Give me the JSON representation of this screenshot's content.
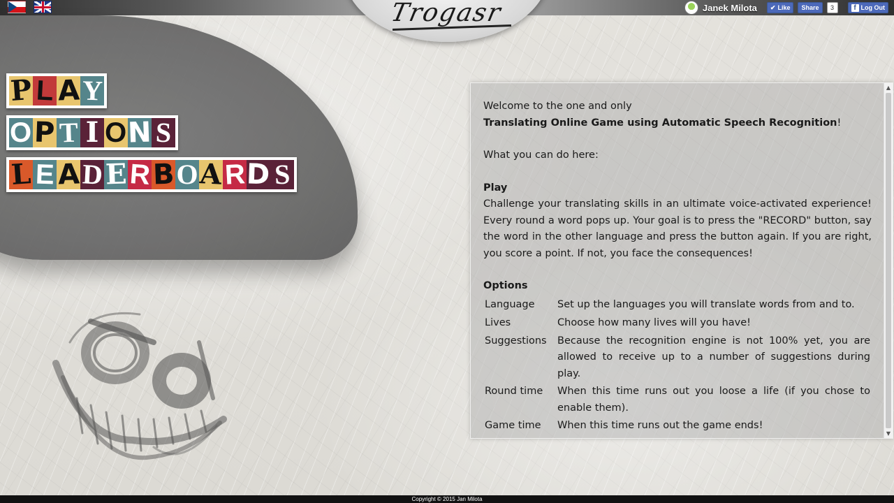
{
  "header": {
    "flags": [
      {
        "icon": "czech-flag-icon"
      },
      {
        "icon": "uk-flag-icon"
      }
    ],
    "user": {
      "name": "Janek Milota"
    },
    "facebook": {
      "like_label": "Like",
      "share_label": "Share",
      "share_count": "3",
      "logout_label": "Log Out"
    }
  },
  "logo": {
    "text": "Trogasr"
  },
  "menu": {
    "play": {
      "letters": [
        "P",
        "L",
        "A",
        "Y"
      ]
    },
    "options": {
      "letters": [
        "O",
        "P",
        "T",
        "I",
        "O",
        "N",
        "S"
      ]
    },
    "leaderboards": {
      "letters": [
        "L",
        "E",
        "A",
        "D",
        "E",
        "R",
        "B",
        "O",
        "A",
        "R",
        "D",
        "S"
      ]
    }
  },
  "colors": {
    "tile_yellow": "#e8c56e",
    "tile_red": "#c23a3a",
    "tile_teal": "#55858b",
    "tile_plum": "#5a2238",
    "tile_crimson": "#c52a45",
    "tile_orange": "#d9592a"
  },
  "info": {
    "intro_line1": "Welcome to the one and only",
    "intro_line2": "Translating Online Game using Automatic Speech Recognition",
    "intro_line2_suffix": "!",
    "what_you_can_do": "What you can do here:",
    "play_heading": "Play",
    "play_text": "Challenge your translating skills in an ultimate voice-activated experience! Every round a word pops up. Your goal is to press the \"RECORD\" button, say the word in the other language and press the button again. If you are right, you score a point. If not, you face the consequences!",
    "options_heading": "Options",
    "options": [
      {
        "name": "Language",
        "desc": "Set up the languages you will translate words from and to."
      },
      {
        "name": "Lives",
        "desc": "Choose how many lives will you have!"
      },
      {
        "name": "Suggestions",
        "desc": "Because the recognition engine is not 100% yet, you are allowed to receive up to a number of suggestions during play."
      },
      {
        "name": "Round time",
        "desc": "When this time runs out you loose a life (if you chose to enable them)."
      },
      {
        "name": "Game time",
        "desc": "When this time runs out the game ends!"
      }
    ]
  },
  "footer": {
    "copyright": "Copyright © 2015 Jan Milota"
  }
}
